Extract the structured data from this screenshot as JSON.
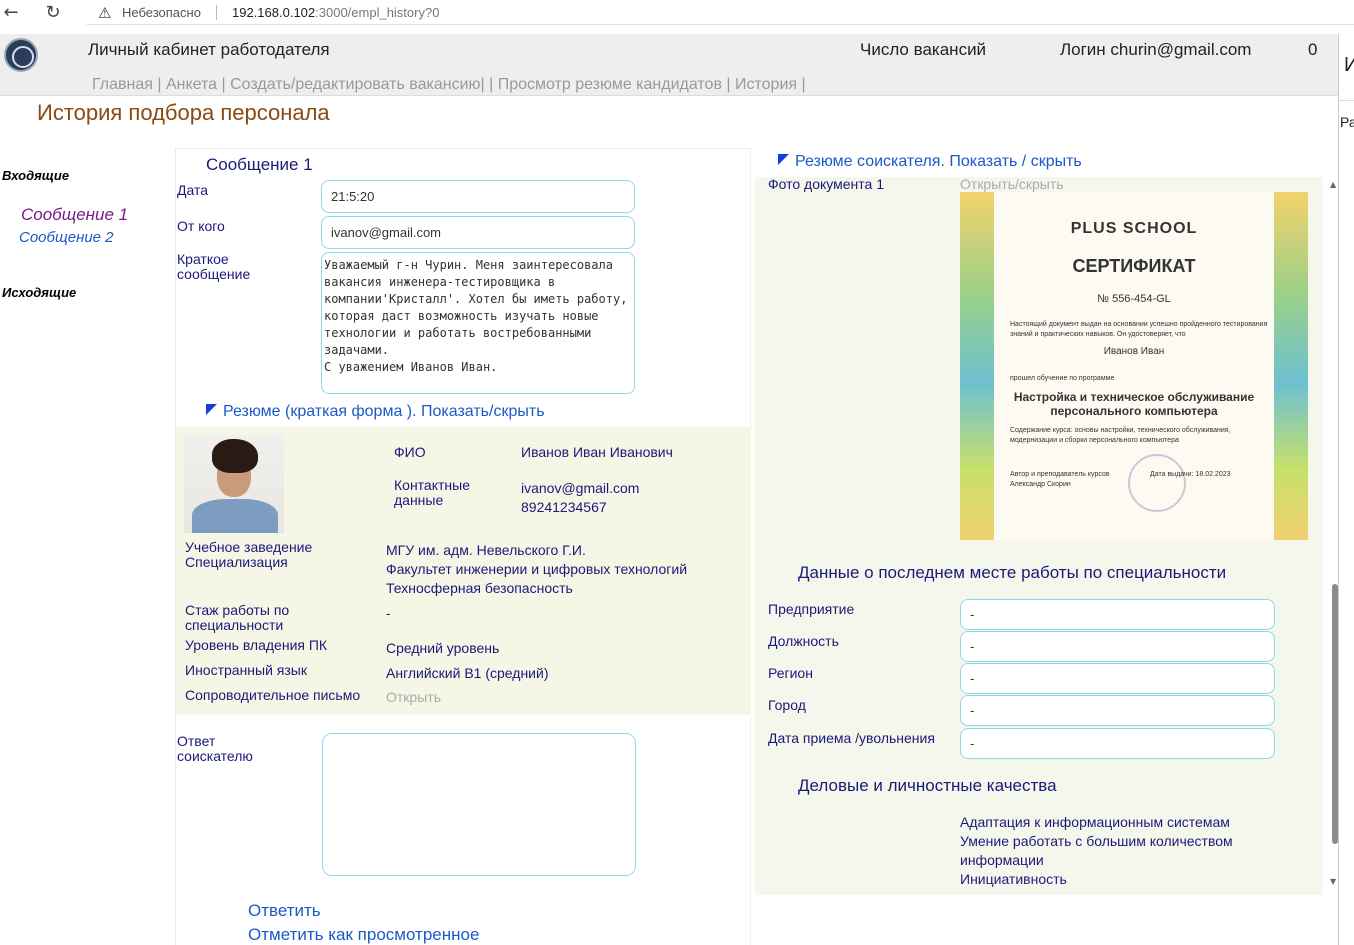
{
  "browser": {
    "back_icon": "←",
    "reload_icon": "↻",
    "insecure_label": "Небезопасно",
    "url_host": "192.168.0.102",
    "url_rest": ":3000/empl_history?0"
  },
  "header": {
    "cabinet_title": "Личный кабинет работодателя",
    "vacancy_count_label": "Число вакансий",
    "login_label": "Логин churin@gmail.com",
    "counter": "0"
  },
  "menu": {
    "items": [
      "Главная",
      "Анкета",
      "Создать/редактировать вакансию",
      "Просмотр резюме кандидатов",
      "История"
    ]
  },
  "right_edge": {
    "text1": "И",
    "text2": "Ра"
  },
  "page_title": "История подбора персонала",
  "sidebar": {
    "incoming_label": "Входящие",
    "messages": [
      "Сообщение 1",
      "Сообщение 2"
    ],
    "outgoing_label": "Исходящие"
  },
  "message": {
    "title": "Сообщение 1",
    "date_label": "Дата",
    "date_value": "21:5:20",
    "from_label": "От кого",
    "from_value": "ivanov@gmail.com",
    "short_label": "Краткое сообщение",
    "short_text": "Уважаемый г-н Чурин. Меня заинтересовала вакансия инженера-тестировщика в компании'Кристалл'. Хотел бы иметь работу, которая даст возможность изучать новые технологии и работать востребованными задачами.\nС уважением Иванов Иван.",
    "resume_toggle": "Резюме (краткая форма ). Показать/скрыть"
  },
  "resume_short": {
    "fio_label": "ФИО",
    "fio_value": "Иванов Иван Иванович",
    "contacts_label": "Контактные данные",
    "contacts_email": "ivanov@gmail.com",
    "contacts_phone": "89241234567",
    "edu_label": "Учебное заведение",
    "spec_label": "Специализация",
    "edu_value": "МГУ им. адм. Невельского Г.И.",
    "faculty_value": "Факультет инженерии и цифровых технологий",
    "spec_value": "Техносферная безопасность",
    "experience_label": "Стаж работы по специальности",
    "experience_value": "-",
    "pc_label": "Уровень владения ПК",
    "pc_value": "Средний уровень",
    "lang_label": "Иностранный язык",
    "lang_value": "Английский В1 (средний)",
    "cover_label": "Сопроводительное письмо",
    "cover_link": "Открыть"
  },
  "reply": {
    "label": "Ответ соискателю",
    "answer_button": "Ответить",
    "mark_viewed_button": "Отметить как просмотренное"
  },
  "resume_full": {
    "toggle": "Резюме соискателя. Показать / скрыть",
    "doc_photo_label": "Фото документа 1",
    "doc_photo_toggle": "Открыть/скрыть",
    "certificate": {
      "school": "PLUS SCHOOL",
      "title": "СЕРТИФИКАТ",
      "number": "№ 556-454-GL",
      "intro": "Настоящий документ выдан на основании успешно пройденного тестирования знаний и практических навыков. Он удостоверяет, что",
      "name": "Иванов Иван",
      "program_intro": "прошел обучение по программе",
      "program": "Настройка и техническое обслуживание персонального компьютера",
      "content": "Содержание курса: основы настройки, технического обслуживания, модернизации и сборки персонального компьютера",
      "author_label": "Автор и преподаватель курсов",
      "author_name": "Александр Скорин",
      "issue_date": "Дата выдачи: 18.02.2023"
    },
    "last_job_title": "Данные о последнем месте работы по специальности",
    "company_label": "Предприятие",
    "company_value": "-",
    "position_label": "Должность",
    "position_value": "-",
    "region_label": "Регион",
    "region_value": "-",
    "city_label": "Город",
    "city_value": "-",
    "dates_label": "Дата приема /увольнения",
    "dates_value": "-",
    "qualities_title": "Деловые и личностные качества",
    "qualities": [
      "Адаптация к информационным системам",
      "Умение работать с большим количеством информации",
      "Инициативность"
    ]
  }
}
